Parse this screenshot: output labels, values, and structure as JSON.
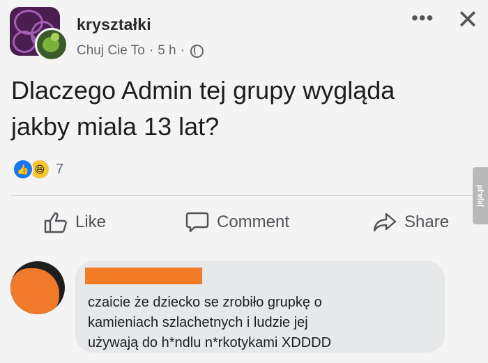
{
  "post": {
    "group_name": "kryształki",
    "author": "Chuj Cie To",
    "time": "5 h",
    "separator": "·",
    "text_line1": "Dlaczego Admin tej grupy wygląda",
    "text_line2": "jakby miala 13 lat?",
    "reaction_count": "7",
    "icons": {
      "more": "more-icon",
      "close": "close-icon",
      "privacy": "globe-icon"
    }
  },
  "actions": {
    "like_label": "Like",
    "comment_label": "Comment",
    "share_label": "Share"
  },
  "comment": {
    "line1": "czaicie że dziecko se zrobiło grupkę o",
    "line2": "kamieniach szlachetnych i ludzie jej",
    "line3": "używają do h*ndlu n*rkotykami XDDDD"
  },
  "watermark": {
    "text": "jeja.pl"
  },
  "colors": {
    "like_blue": "#1877f2",
    "haha_yellow": "#f7c531",
    "redaction_orange": "#f27b25",
    "bubble_gray": "#e7e8ea"
  }
}
